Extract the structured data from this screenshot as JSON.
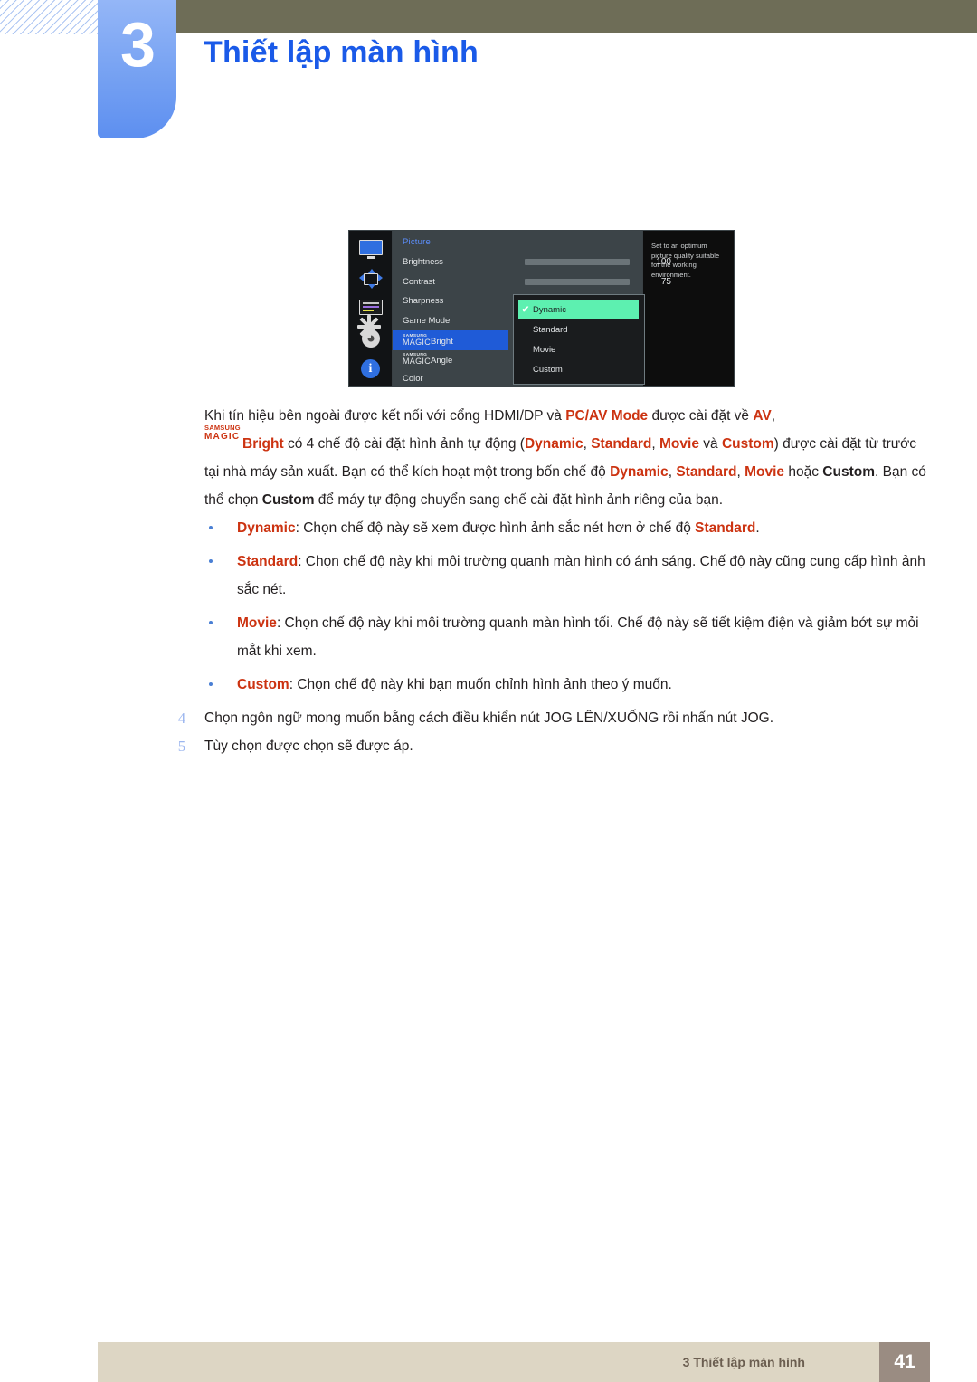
{
  "header": {
    "chapter_number": "3",
    "chapter_title": "Thiết lập màn hình",
    "title_color": "#1a5ae8",
    "bar_color": "#6e6d57"
  },
  "osd": {
    "sidebar_icons": [
      "picture-icon",
      "screen-adjust-icon",
      "osd-icon",
      "system-gear-icon",
      "information-icon"
    ],
    "heading": "Picture",
    "rows": [
      {
        "label": "Brightness",
        "value": "100",
        "bar": 100
      },
      {
        "label": "Contrast",
        "value": "75",
        "bar": 75
      },
      {
        "label": "Sharpness",
        "value": "",
        "bar": null
      },
      {
        "label": "Game Mode",
        "value": "",
        "bar": null
      }
    ],
    "magic_rows": [
      {
        "sam": "SAMSUNG",
        "mag": "MAGIC",
        "suffix": "Bright",
        "highlighted": true
      },
      {
        "sam": "SAMSUNG",
        "mag": "MAGIC",
        "suffix": "Angle",
        "highlighted": false
      }
    ],
    "color_row": "Color",
    "dropdown": {
      "check_glyph": "✔",
      "items": [
        {
          "label": "Dynamic",
          "selected": true
        },
        {
          "label": "Standard",
          "selected": false
        },
        {
          "label": "Movie",
          "selected": false
        },
        {
          "label": "Custom",
          "selected": false
        }
      ],
      "highlight_color": "#5df0b0"
    },
    "description": "Set to an optimum picture quality suitable for the working environment."
  },
  "body": {
    "paragraph": {
      "p1": "Khi tín hiệu bên ngoài được kết nối với cổng HDMI/DP và ",
      "pc_av_mode": "PC/AV Mode",
      "p2": " được cài đặt về ",
      "av": "AV",
      "p3": ",",
      "magic_sam": "SAMSUNG",
      "magic_mag": "MAGIC",
      "magic_bright": "Bright",
      "p4": " có 4 chế độ cài đặt hình ảnh tự động (",
      "m_dynamic": "Dynamic",
      "p5": ", ",
      "m_standard": "Standard",
      "p6": ", ",
      "m_movie": "Movie",
      "p7": " và ",
      "m_custom": "Custom",
      "p8": ") được cài đặt từ trước tại nhà máy sản xuất. Bạn có thể kích hoạt một trong bốn chế độ ",
      "m_dynamic2": "Dynamic",
      "p9": ", ",
      "m_standard2": "Standard",
      "p10": ", ",
      "m_movie2": "Movie",
      "p11": " hoặc ",
      "m_custom2": "Custom",
      "p12": ". Bạn có thể chọn ",
      "m_custom3": "Custom",
      "p13": " để máy tự động chuyển sang chế cài đặt hình ảnh riêng của bạn."
    },
    "bullets": [
      {
        "term": "Dynamic",
        "text_before": ": Chọn chế độ này sẽ xem được hình ảnh sắc nét hơn ở chế độ ",
        "term2": "Standard",
        "text_after": "."
      },
      {
        "term": "Standard",
        "text_before": ": Chọn chế độ này khi môi trường quanh màn hình có ánh sáng. Chế độ này cũng cung cấp hình ảnh sắc nét.",
        "term2": "",
        "text_after": ""
      },
      {
        "term": "Movie",
        "text_before": ": Chọn chế độ này khi môi trường quanh màn hình tối. Chế độ này sẽ tiết kiệm điện và giảm bớt sự mỏi mắt khi xem.",
        "term2": "",
        "text_after": ""
      },
      {
        "term": "Custom",
        "text_before": ": Chọn chế độ này khi bạn muốn chỉnh hình ảnh theo ý muốn.",
        "term2": "",
        "text_after": ""
      }
    ],
    "steps": [
      {
        "num": "4",
        "text": "Chọn ngôn ngữ mong muốn bằng cách điều khiển nút JOG LÊN/XUỐNG rồi nhấn nút JOG."
      },
      {
        "num": "5",
        "text": "Tùy chọn được chọn sẽ được áp."
      }
    ]
  },
  "footer": {
    "text": "3 Thiết lập màn hình",
    "page": "41"
  }
}
